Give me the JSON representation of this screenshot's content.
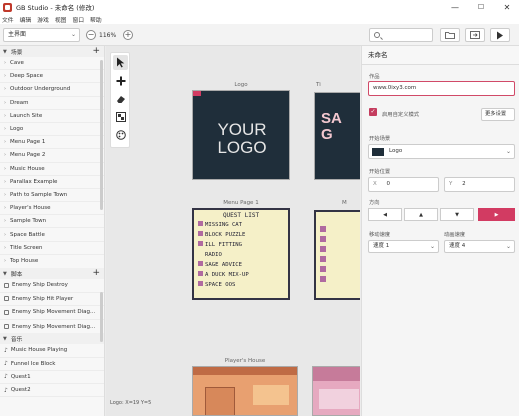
{
  "window": {
    "title": "GB Studio - 未命名 (修改)",
    "minimize": "—",
    "maximize": "☐",
    "close": "✕"
  },
  "menu": [
    "文件",
    "编辑",
    "游戏",
    "视图",
    "窗口",
    "帮助"
  ],
  "toolbar": {
    "scene_select": "主界面",
    "zoom_minus": "−",
    "zoom_value": "116%",
    "zoom_plus": "+"
  },
  "sidebar": {
    "scenes_header": "场景",
    "scenes": [
      "Cave",
      "Deep Space",
      "Outdoor Underground",
      "Dream",
      "Launch Site",
      "Logo",
      "Menu Page 1",
      "Menu Page 2",
      "Music House",
      "Parallax Example",
      "Path to Sample Town",
      "Player's House",
      "Sample Town",
      "Space Battle",
      "Title Screen",
      "Top House"
    ],
    "scripts_header": "脚本",
    "scripts": [
      "Enemy Ship Destroy",
      "Enemy Ship Hit Player",
      "Enemy Ship Movement Diag...",
      "Enemy Ship Movement Diag..."
    ],
    "music_header": "音乐",
    "music": [
      "Music House Playing",
      "Funnel Ice Block",
      "Quest1",
      "Quest2"
    ]
  },
  "canvas": {
    "scenes": [
      {
        "label": "Logo",
        "text_line1": "YOUR",
        "text_line2": "LOGO"
      },
      {
        "label": "Ti",
        "text": "SA G"
      },
      {
        "label": "Menu Page 1",
        "title": "QUEST LIST",
        "items": [
          "MISSING CAT",
          "BLOCK PUZZLE",
          "ILL FITTING",
          "RADIO",
          "SAGE ADVICE",
          "A DUCK MIX-UP",
          "SPACE OOS"
        ]
      },
      {
        "label": "M"
      },
      {
        "label": "Player's House"
      }
    ],
    "status": "Logo: X=19 Y=5"
  },
  "rpanel": {
    "title": "未命名",
    "notes_label": "作品",
    "notes_value": "www.0ixy3.com",
    "checkbox_label": "启用自定义模式",
    "more_button": "更多设置",
    "start_scene_label": "开始场景",
    "start_scene_value": "Logo",
    "start_pos_label": "开始位置",
    "x_label": "X",
    "x_value": "0",
    "y_label": "Y",
    "y_value": "2",
    "direction_label": "方向",
    "directions": [
      "◀",
      "▲",
      "▼",
      "▶"
    ],
    "move_speed_label": "移动速度",
    "move_speed_value": "速度 1",
    "anim_speed_label": "动画速度",
    "anim_speed_value": "速度 4"
  },
  "colors": {
    "accent": "#d23b62",
    "scene_bg": "#1f2e3a",
    "menu_bg": "#f5f0c8"
  }
}
